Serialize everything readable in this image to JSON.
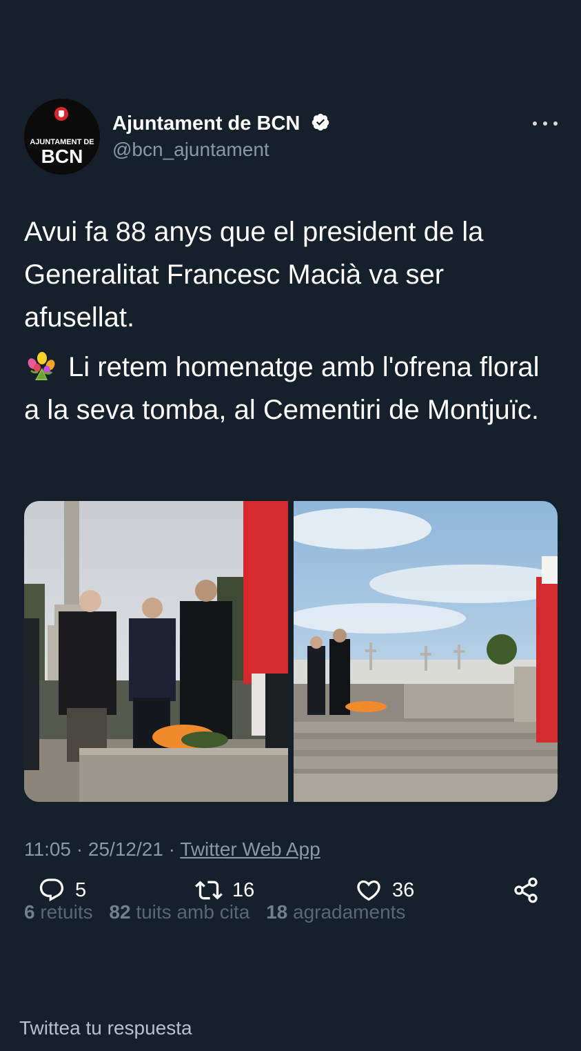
{
  "account": {
    "display_name": "Ajuntament de BCN",
    "handle": "@bcn_ajuntament",
    "avatar_line1": "AJUNTAMENT DE",
    "avatar_line2": "BCN",
    "verified": true
  },
  "tweet": {
    "paragraph1": "Avui fa 88 anys que el president de la Generalitat Francesc Macià va ser afusellat.",
    "paragraph2_emoji": "bouquet-icon",
    "paragraph2": "Li retem homenatge amb l'ofrena floral a la seva tomba, al Cementiri de Montjuïc.",
    "media": [
      {
        "kind": "photo",
        "subject": "officials-at-tomb"
      },
      {
        "kind": "photo",
        "subject": "cemetery-wide-view"
      }
    ],
    "time": "11:05",
    "date": "25/12/21",
    "separator": "·",
    "source": "Twitter Web App"
  },
  "actions": {
    "replies": "5",
    "retweets": "16",
    "likes": "36",
    "icons": [
      "reply-icon",
      "retweet-icon",
      "like-icon",
      "share-icon"
    ]
  },
  "stats": {
    "retweets_num": "6",
    "retweets_label": "retuits",
    "quotes_num": "82",
    "quotes_label": "tuits amb cita",
    "likes_num": "18",
    "likes_label": "agradaments"
  },
  "reply": {
    "placeholder": "Twittea tu respuesta"
  },
  "colors": {
    "background": "#15202b",
    "text_primary": "#ffffff",
    "text_secondary": "#8b98a5",
    "verified": "#ffffff"
  }
}
